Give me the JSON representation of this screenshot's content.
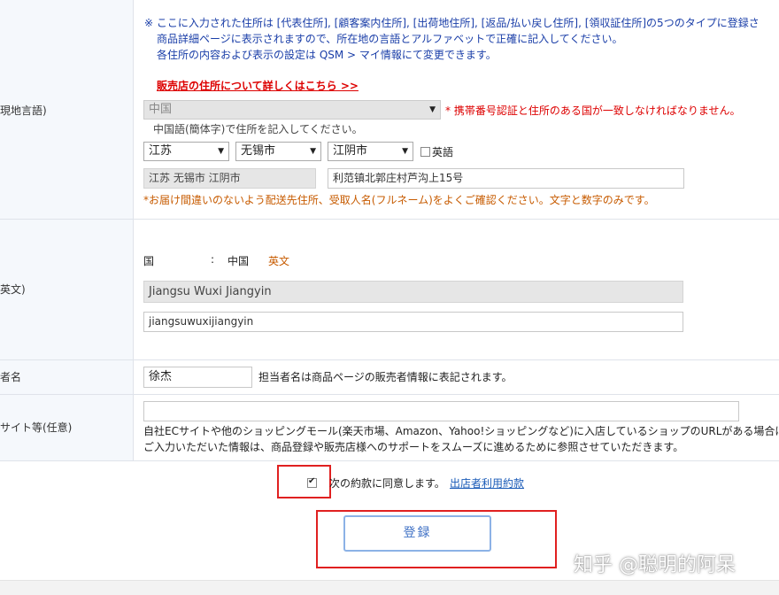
{
  "labels": {
    "local_lang": "現地言語)",
    "english": "英文)",
    "name": "者名",
    "site": "サイト等(任意)"
  },
  "notice": {
    "line1": "※ ここに入力された住所は [代表住所], [顧客案内住所], [出荷地住所], [返品/払い戻し住所], [領収証住所]の5つのタイプに登録さ",
    "line2": "商品詳細ページに表示されますので、所在地の言語とアルファベットで正確に記入してください。",
    "line3": "各住所の内容および表示の設定は  QSM > マイ情報にて変更できます。",
    "link": "販売店の住所について詳しくはこちら >>"
  },
  "local": {
    "country": "中国",
    "country_warning": "* 携帯番号認証と住所のある国が一致しなければなりません。",
    "hint": "中国語(簡体字)で住所を記入してください。",
    "province": "江苏",
    "city": "无锡市",
    "district": "江阴市",
    "english_option": "英語",
    "area_value": "江苏 无锡市 江阴市",
    "street_value": "利范镇北郭庄村芦沟上15号",
    "warning": "*お届け間違いのないよう配送先住所、受取人名(フルネーム)をよくご確認ください。文字と数字のみです。"
  },
  "english": {
    "country_label": "国",
    "colon": ":",
    "country": "中国",
    "country_en": "英文",
    "area_value": "Jiangsu Wuxi Jiangyin",
    "street_value": "jiangsuwuxijiangyin"
  },
  "name": {
    "value": "徐杰",
    "note": "担当者名は商品ページの販売者情報に表記されます。"
  },
  "site": {
    "value": "",
    "note1": "自社ECサイトや他のショッピングモール(楽天市場、Amazon、Yahoo!ショッピングなど)に入店しているショップのURLがある場合は",
    "note2": "ご入力いただいた情報は、商品登録や販売店様へのサポートをスムーズに進めるために参照させていただきます。"
  },
  "agree": {
    "text": "次の約款に同意します。",
    "link": "出店者利用約款"
  },
  "submit_label": "登録",
  "watermark": "知乎 @聪明的阿呆"
}
